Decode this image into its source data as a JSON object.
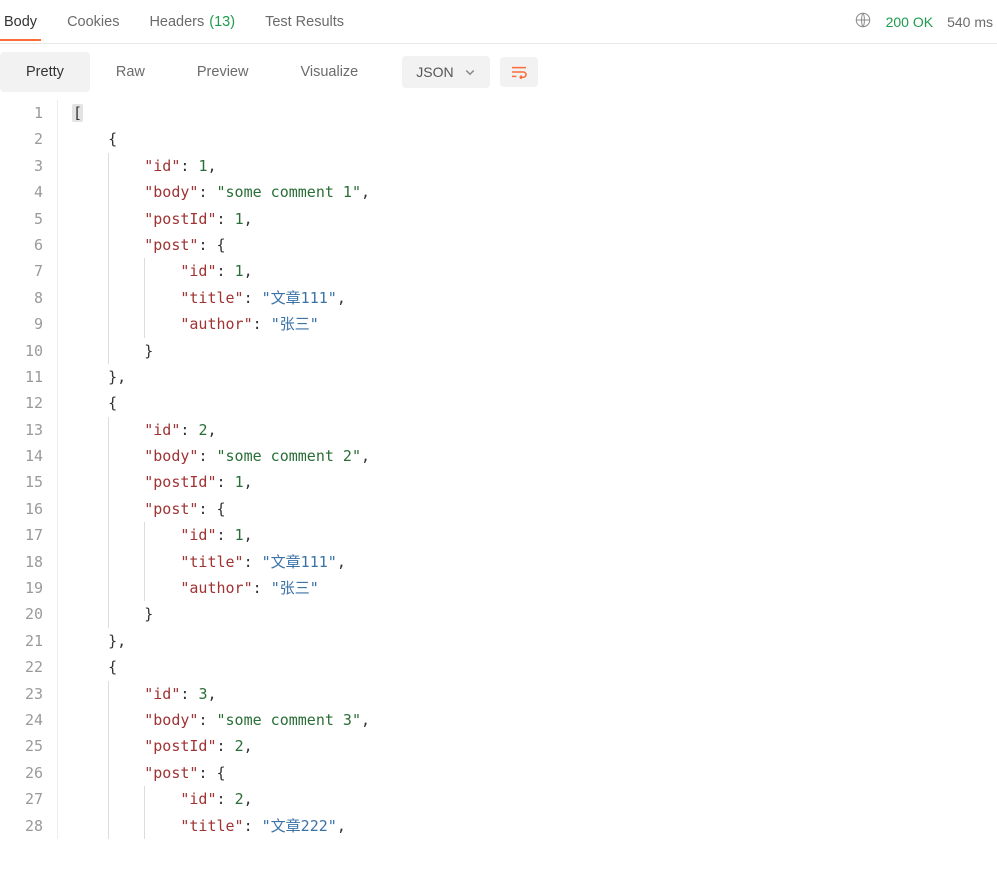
{
  "tabs": {
    "body": "Body",
    "cookies": "Cookies",
    "headers": "Headers",
    "headers_count": "(13)",
    "test_results": "Test Results"
  },
  "status": {
    "code": "200 OK",
    "time": "540 ms"
  },
  "subtabs": {
    "pretty": "Pretty",
    "raw": "Raw",
    "preview": "Preview",
    "visualize": "Visualize"
  },
  "format_select": "JSON",
  "code": {
    "lines": [
      "1",
      "2",
      "3",
      "4",
      "5",
      "6",
      "7",
      "8",
      "9",
      "10",
      "11",
      "12",
      "13",
      "14",
      "15",
      "16",
      "17",
      "18",
      "19",
      "20",
      "21",
      "22",
      "23",
      "24",
      "25",
      "26",
      "27",
      "28"
    ]
  },
  "json_body": [
    {
      "id": 1,
      "body": "some comment 1",
      "postId": 1,
      "post": {
        "id": 1,
        "title": "文章111",
        "author": "张三"
      }
    },
    {
      "id": 2,
      "body": "some comment 2",
      "postId": 1,
      "post": {
        "id": 1,
        "title": "文章111",
        "author": "张三"
      }
    },
    {
      "id": 3,
      "body": "some comment 3",
      "postId": 2,
      "post": {
        "id": 2,
        "title": "文章222"
      }
    }
  ],
  "tokens": {
    "open_bracket": "[",
    "open_brace": "{",
    "close_brace": "}",
    "close_brace_comma": "},",
    "id_key": "\"id\"",
    "body_key": "\"body\"",
    "postId_key": "\"postId\"",
    "post_key": "\"post\"",
    "title_key": "\"title\"",
    "author_key": "\"author\"",
    "colon_sp": ": ",
    "comma": ",",
    "v1": "1",
    "v2": "2",
    "v3": "3",
    "comment1": "\"some comment 1\"",
    "comment2": "\"some comment 2\"",
    "comment3": "\"some comment 3\"",
    "title111": "\"文章111\"",
    "title222": "\"文章222\"",
    "author_zs": "\"张三\""
  }
}
